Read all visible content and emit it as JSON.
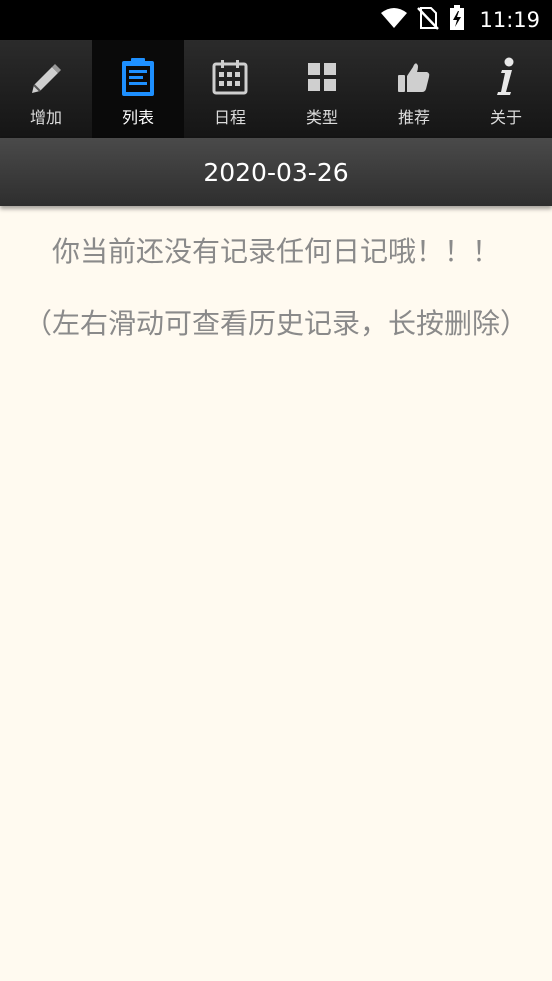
{
  "status_bar": {
    "time": "11:19",
    "icons": [
      "wifi-icon",
      "no-sim-icon",
      "battery-charging-icon"
    ]
  },
  "toolbar": {
    "tabs": [
      {
        "label": "增加",
        "icon": "pencil-icon",
        "active": false
      },
      {
        "label": "列表",
        "icon": "clipboard-list-icon",
        "active": true
      },
      {
        "label": "日程",
        "icon": "calendar-icon",
        "active": false
      },
      {
        "label": "类型",
        "icon": "grid-icon",
        "active": false
      },
      {
        "label": "推荐",
        "icon": "thumbs-up-icon",
        "active": false
      },
      {
        "label": "关于",
        "icon": "info-icon",
        "active": false
      }
    ],
    "active_color": "#1e90ff"
  },
  "date_bar": {
    "date": "2020-03-26"
  },
  "content": {
    "empty_message": "你当前还没有记录任何日记哦！！！",
    "hint": "（左右滑动可查看历史记录，长按删除）"
  }
}
